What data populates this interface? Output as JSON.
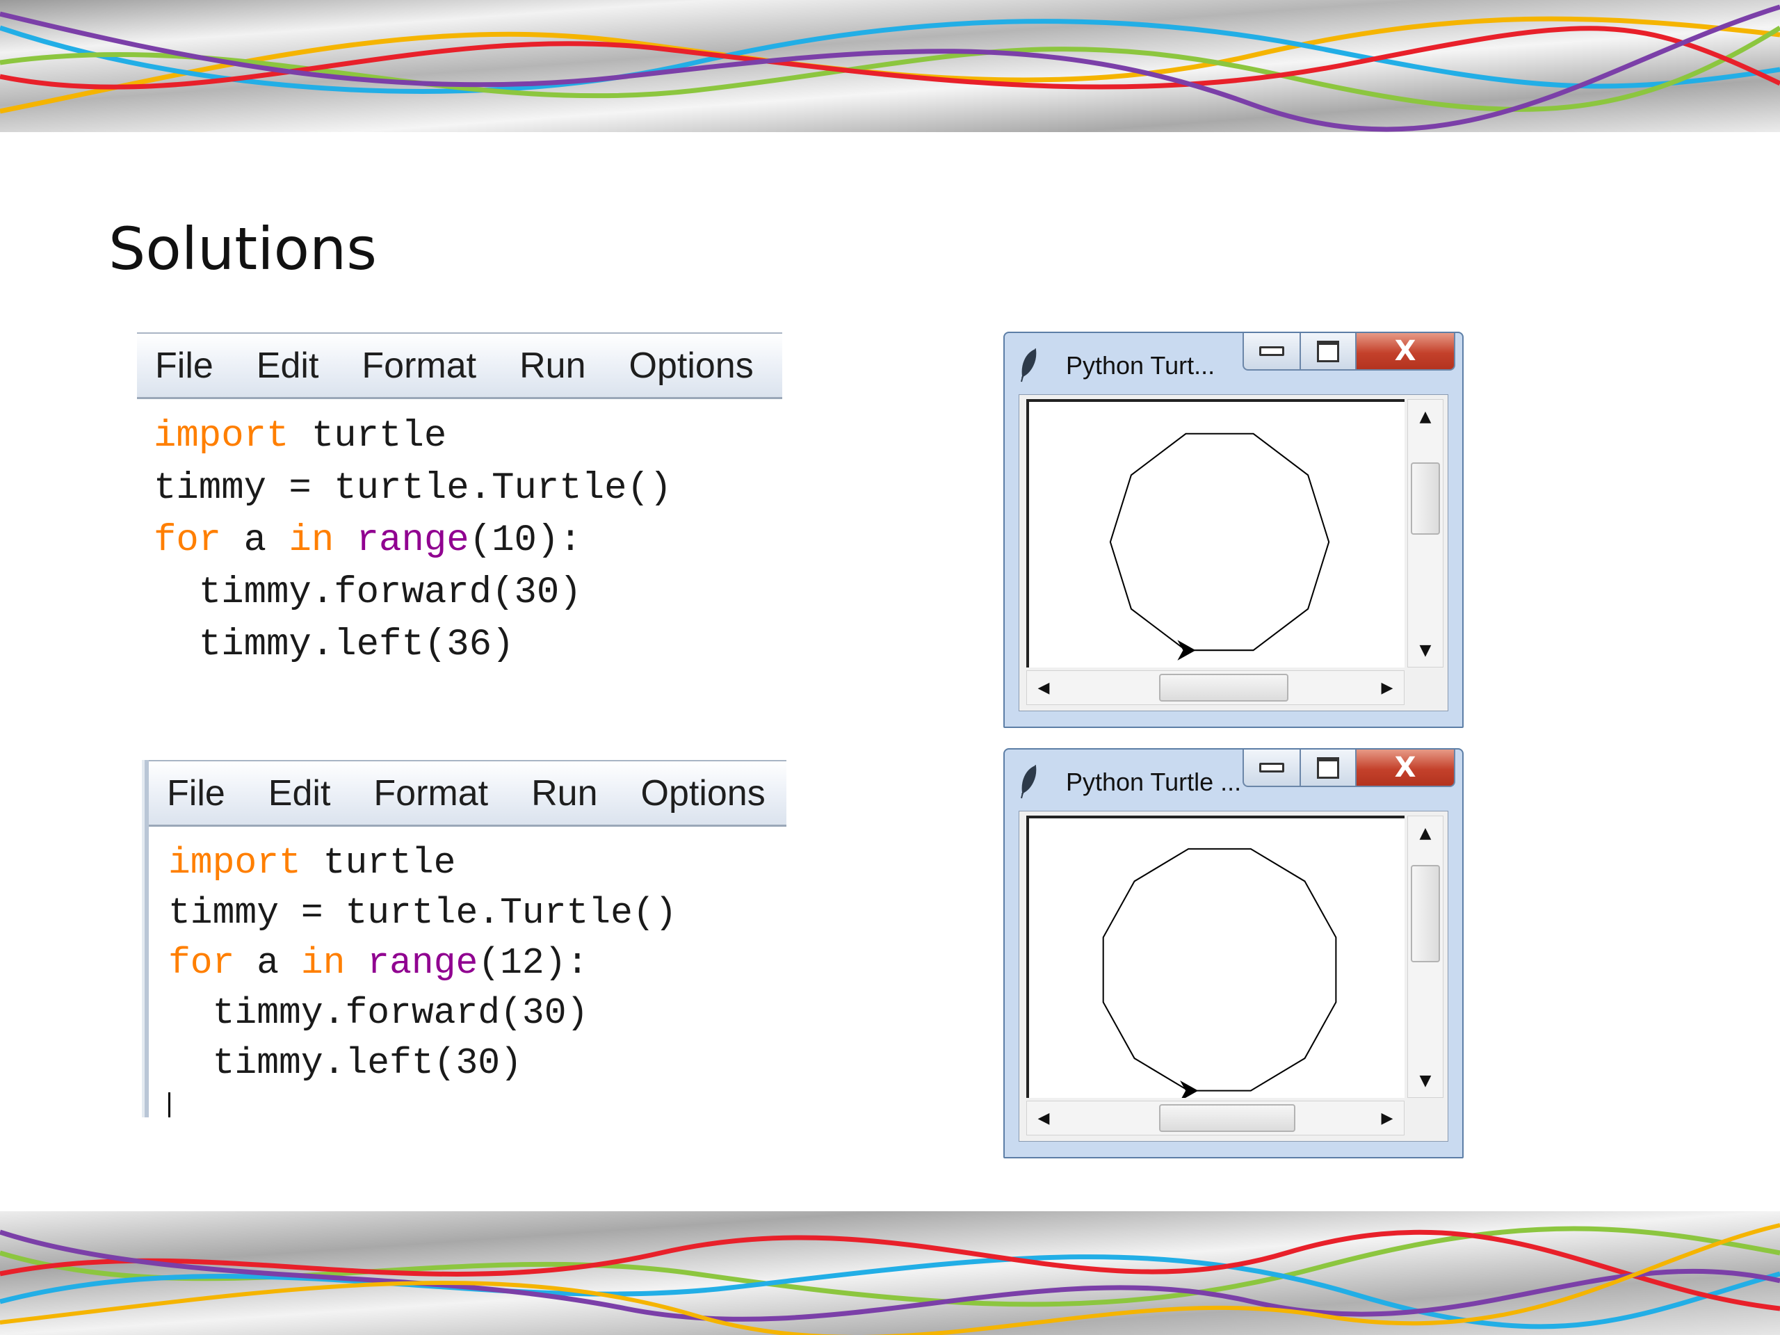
{
  "slide": {
    "title": "Solutions"
  },
  "editors": [
    {
      "menu": [
        "File",
        "Edit",
        "Format",
        "Run",
        "Options"
      ],
      "lines": [
        [
          {
            "t": "import",
            "c": "kw"
          },
          {
            "t": " turtle"
          }
        ],
        [
          {
            "t": "timmy = turtle.Turtle()"
          }
        ],
        [
          {
            "t": "for",
            "c": "kw"
          },
          {
            "t": " a "
          },
          {
            "t": "in",
            "c": "kw"
          },
          {
            "t": " "
          },
          {
            "t": "range",
            "c": "bi"
          },
          {
            "t": "(10):"
          }
        ],
        [
          {
            "t": "  timmy.forward(30)"
          }
        ],
        [
          {
            "t": "  timmy.left(36)"
          }
        ]
      ]
    },
    {
      "menu": [
        "File",
        "Edit",
        "Format",
        "Run",
        "Options"
      ],
      "lines": [
        [
          {
            "t": "import",
            "c": "kw"
          },
          {
            "t": " turtle"
          }
        ],
        [
          {
            "t": "timmy = turtle.Turtle()"
          }
        ],
        [
          {
            "t": "for",
            "c": "kw"
          },
          {
            "t": " a "
          },
          {
            "t": "in",
            "c": "kw"
          },
          {
            "t": " "
          },
          {
            "t": "range",
            "c": "bi"
          },
          {
            "t": "(12):"
          }
        ],
        [
          {
            "t": "  timmy.forward(30)"
          }
        ],
        [
          {
            "t": "  timmy.left(30)"
          }
        ]
      ]
    }
  ],
  "turtle_windows": [
    {
      "title": "Python Turt...",
      "close_glyph": "X",
      "sides": 10
    },
    {
      "title": "Python Turtle ...",
      "close_glyph": "X",
      "sides": 12
    }
  ],
  "icons": {
    "feather": "feather-icon",
    "minimize": "minimize-icon",
    "maximize": "maximize-icon",
    "close": "close-icon",
    "scroll_up": "▲",
    "scroll_down": "▼",
    "scroll_left": "◀",
    "scroll_right": "▶"
  },
  "colors": {
    "keyword": "#ff7f00",
    "builtin": "#900090",
    "ribbon": [
      "#e8202a",
      "#7b3fa8",
      "#22aee6",
      "#8cc63f",
      "#f5b400"
    ]
  }
}
